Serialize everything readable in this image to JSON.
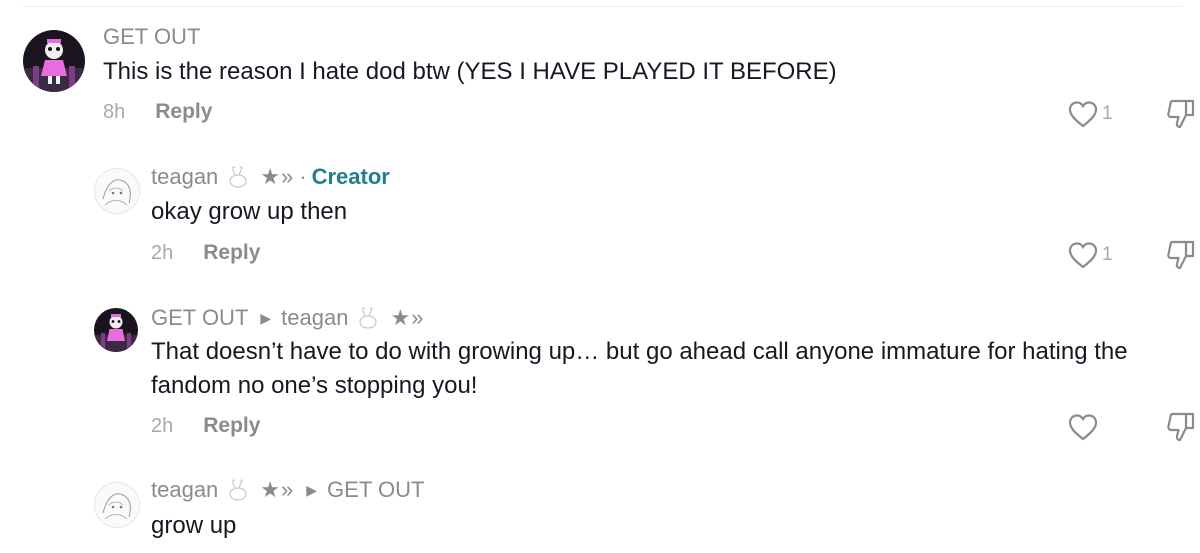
{
  "comments": [
    {
      "username": "GET OUT",
      "text": "This is the reason I hate dod btw (YES I HAVE PLAYED IT BEFORE)",
      "time": "8h",
      "reply_label": "Reply",
      "like_count": "1",
      "avatar_icon": "pink-character-avatar"
    },
    {
      "username": "teagan",
      "name_deco": "★»",
      "separator": "·",
      "badge": "Creator",
      "text": "okay grow up then",
      "time": "2h",
      "reply_label": "Reply",
      "like_count": "1",
      "avatar_icon": "sketch-avatar"
    },
    {
      "username": "GET OUT",
      "reply_to_arrow": "▶",
      "reply_to_name": "teagan",
      "reply_to_deco": "★»",
      "text": "That doesn’t have to do with growing up… but go ahead call anyone immature for hating the fandom no one’s stopping you!",
      "time": "2h",
      "reply_label": "Reply",
      "like_count": "",
      "avatar_icon": "pink-character-avatar"
    },
    {
      "username": "teagan",
      "name_deco": "★»",
      "reply_to_arrow": "▶",
      "reply_to_name": "GET OUT",
      "text": "grow up",
      "avatar_icon": "sketch-avatar"
    }
  ],
  "colors": {
    "creator_badge": "#20808d",
    "muted_text": "#8a8b91",
    "body_text": "#161823",
    "avatar_pink": "#e76ce0"
  }
}
